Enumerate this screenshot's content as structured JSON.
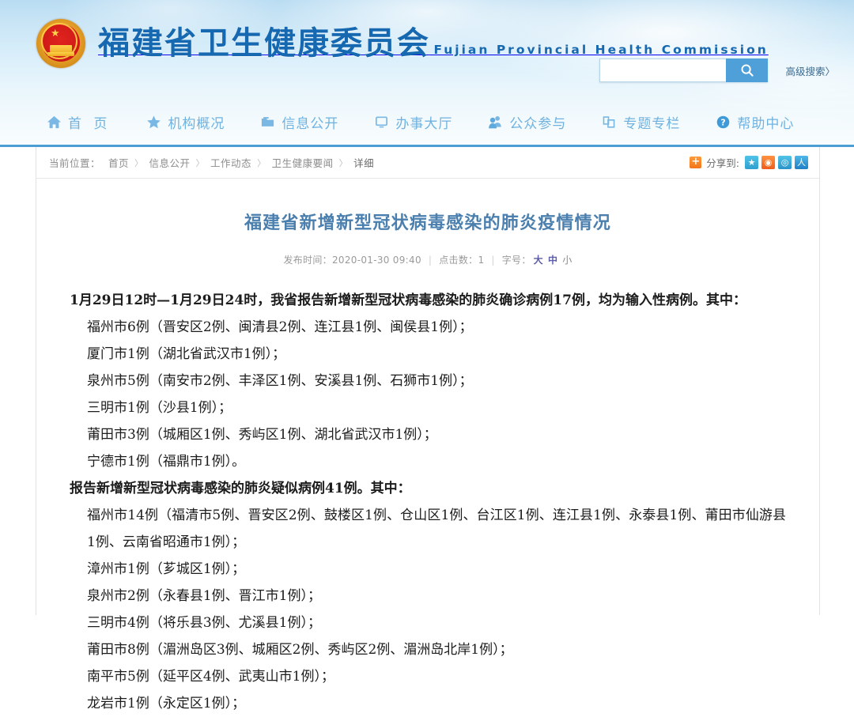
{
  "header": {
    "emblem_alt": "national-emblem",
    "site_title_cn": "福建省卫生健康委员会",
    "site_title_en": "Fujian Provincial Health Commission",
    "brand_color": "#1668b0",
    "search": {
      "value": "",
      "placeholder": "",
      "button_icon": "search-icon",
      "advanced_label": "高级搜索〉"
    },
    "nav": [
      {
        "label": "首 页",
        "icon": "home-icon"
      },
      {
        "label": "机构概况",
        "icon": "star-icon"
      },
      {
        "label": "信息公开",
        "icon": "folder-icon"
      },
      {
        "label": "办事大厅",
        "icon": "monitor-icon"
      },
      {
        "label": "公众参与",
        "icon": "users-icon"
      },
      {
        "label": "专题专栏",
        "icon": "pages-icon"
      },
      {
        "label": "帮助中心",
        "icon": "question-circle-icon"
      }
    ]
  },
  "breadcrumb": {
    "label": "当前位置：",
    "separator": "〉",
    "items": [
      "首页",
      "信息公开",
      "工作动态",
      "卫生健康要闻"
    ],
    "current": "详细"
  },
  "share": {
    "plus": "+",
    "label": "分享到:",
    "icons": [
      {
        "name": "favorite-icon",
        "glyph": "★"
      },
      {
        "name": "weibo-icon",
        "glyph": "◉"
      },
      {
        "name": "qq-icon",
        "glyph": "◎"
      },
      {
        "name": "renren-icon",
        "glyph": "人"
      }
    ]
  },
  "article": {
    "title": "福建省新增新型冠状病毒感染的肺炎疫情情况",
    "meta": {
      "publish_label": "发布时间：",
      "publish_time": "2020-01-30 09:40",
      "hits_label": "点击数：",
      "hits": "1",
      "fontsize_label": "字号：",
      "fontsize_big": "大",
      "fontsize_mid": "中",
      "fontsize_small": "小"
    },
    "paragraphs": [
      {
        "text": "1月29日12时—1月29日24时，我省报告新增新型冠状病毒感染的肺炎确诊病例17例，均为输入性病例。其中：",
        "bold": true,
        "indent": false
      },
      {
        "text": "福州市6例（晋安区2例、闽清县2例、连江县1例、闽侯县1例）；",
        "bold": false,
        "indent": true
      },
      {
        "text": "厦门市1例（湖北省武汉市1例）；",
        "bold": false,
        "indent": true
      },
      {
        "text": "泉州市5例（南安市2例、丰泽区1例、安溪县1例、石狮市1例）；",
        "bold": false,
        "indent": true
      },
      {
        "text": "三明市1例（沙县1例）；",
        "bold": false,
        "indent": true
      },
      {
        "text": "莆田市3例（城厢区1例、秀屿区1例、湖北省武汉市1例）；",
        "bold": false,
        "indent": true
      },
      {
        "text": "宁德市1例（福鼎市1例）。",
        "bold": false,
        "indent": true
      },
      {
        "text": "报告新增新型冠状病毒感染的肺炎疑似病例41例。其中：",
        "bold": true,
        "indent": false
      },
      {
        "text": "福州市14例（福清市5例、晋安区2例、鼓楼区1例、仓山区1例、台江区1例、连江县1例、永泰县1例、莆田市仙游县1例、云南省昭通市1例）；",
        "bold": false,
        "indent": true
      },
      {
        "text": "漳州市1例（芗城区1例）；",
        "bold": false,
        "indent": true
      },
      {
        "text": "泉州市2例（永春县1例、晋江市1例）；",
        "bold": false,
        "indent": true
      },
      {
        "text": "三明市4例（将乐县3例、尤溪县1例）；",
        "bold": false,
        "indent": true
      },
      {
        "text": "莆田市8例（湄洲岛区3例、城厢区2例、秀屿区2例、湄洲岛北岸1例）；",
        "bold": false,
        "indent": true
      },
      {
        "text": "南平市5例（延平区4例、武夷山市1例）；",
        "bold": false,
        "indent": true
      },
      {
        "text": "龙岩市1例（永定区1例）；",
        "bold": false,
        "indent": true
      }
    ]
  }
}
